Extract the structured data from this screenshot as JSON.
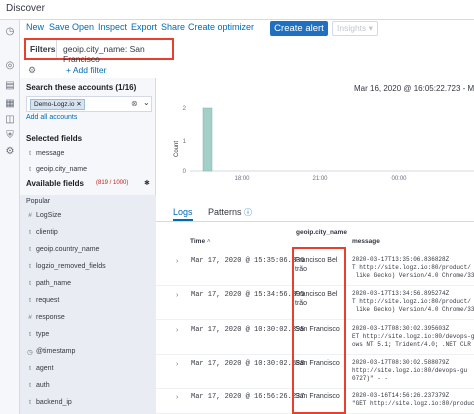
{
  "app": {
    "title": "Discover"
  },
  "toolbar": {
    "items": [
      "New",
      "Save",
      "Open",
      "Inspect",
      "Export",
      "Share",
      "Create optimizer"
    ],
    "create_alert": "Create alert",
    "insights": "Insights"
  },
  "filter": {
    "label": "Filters",
    "value": "geoip.city_name: San Francisco"
  },
  "add_filter": "+ Add filter",
  "sidebar": {
    "accounts_title": "Search these accounts (1/16)",
    "account_chip": "Demo-Logz.io",
    "add_all": "Add all accounts",
    "selected_title": "Selected fields",
    "selected_fields": [
      {
        "icon": "t",
        "name": "message"
      },
      {
        "icon": "t",
        "name": "geoip.city_name"
      }
    ],
    "available_title": "Available fields",
    "available_count": "(819 / 1000)",
    "popular_title": "Popular",
    "popular_fields": [
      {
        "icon": "#",
        "name": "LogSize"
      },
      {
        "icon": "t",
        "name": "clientip"
      },
      {
        "icon": "t",
        "name": "geoip.country_name"
      },
      {
        "icon": "t",
        "name": "logzio_removed_fields"
      },
      {
        "icon": "t",
        "name": "path_name"
      },
      {
        "icon": "t",
        "name": "request"
      },
      {
        "icon": "#",
        "name": "response"
      },
      {
        "icon": "t",
        "name": "type"
      },
      {
        "icon": "◷",
        "name": "@timestamp"
      },
      {
        "icon": "t",
        "name": "agent"
      },
      {
        "icon": "t",
        "name": "auth"
      },
      {
        "icon": "t",
        "name": "backend_ip"
      }
    ]
  },
  "histogram": {
    "date_range": "Mar 16, 2020 @ 16:05:22.723 - Ma",
    "ylabel": "Count",
    "yticks": [
      "2",
      "1",
      "0"
    ],
    "xticks": [
      "18:00",
      "21:00",
      "00:00"
    ],
    "bar": {
      "x_label": "18:00",
      "value": 2
    }
  },
  "tabs": {
    "logs": "Logs",
    "patterns": "Patterns"
  },
  "table": {
    "col_time": "Time",
    "col_city": "geoip.city_name",
    "col_message": "message",
    "rows": [
      {
        "time": "Mar 17, 2020 @ 15:35:06.836",
        "city": "Francisco Bel trão",
        "message": "2020-03-17T13:35:06.836828Z\nT http://site.logz.io:80/product/\n like Gecko) Version/4.0 Chrome/33.0"
      },
      {
        "time": "Mar 17, 2020 @ 15:34:56.895",
        "city": "Francisco Bel trão",
        "message": "2020-03-17T13:34:56.895274Z\nT http://site.logz.io:80/product/\n like Gecko) Version/4.0 Chrome/33.0"
      },
      {
        "time": "Mar 17, 2020 @ 10:30:02.395",
        "city": "San Francisco",
        "message": "2020-03-17T08:30:02.395603Z\nET http://site.logz.io:80/devops-gu\nows NT 5.1; Trident/4.0; .NET CLR 2"
      },
      {
        "time": "Mar 17, 2020 @ 10:30:02.588",
        "city": "San Francisco",
        "message": "2020-03-17T08:30:02.588079Z\nhttp://site.logz.io:80/devops-gu\n0727)\" - -"
      },
      {
        "time": "Mar 17, 2020 @ 16:56:26.237",
        "city": "San Francisco",
        "message": "2020-03-16T14:56:26.237379Z\n\"GET http://site.logz.io:80/product"
      }
    ]
  }
}
